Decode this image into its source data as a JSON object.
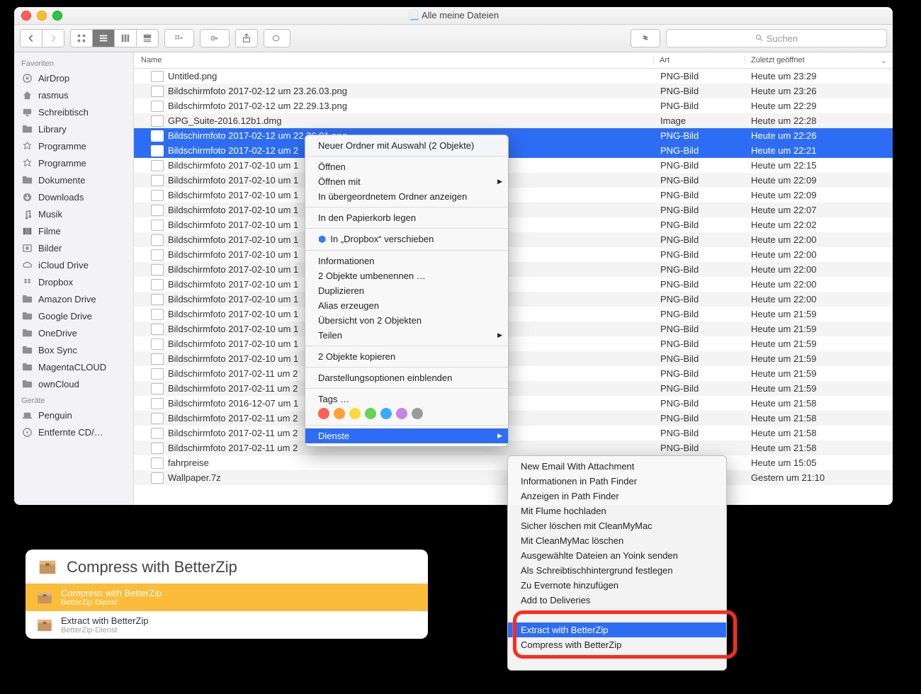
{
  "window": {
    "title": "📃 Alle meine Dateien"
  },
  "search": {
    "placeholder": "Suchen"
  },
  "sidebar": {
    "favorites_label": "Favoriten",
    "devices_label": "Geräte",
    "items": [
      {
        "label": "AirDrop",
        "icon": "airdrop"
      },
      {
        "label": "rasmus",
        "icon": "home"
      },
      {
        "label": "Schreibtisch",
        "icon": "desktop"
      },
      {
        "label": "Library",
        "icon": "folder"
      },
      {
        "label": "Programme",
        "icon": "apps"
      },
      {
        "label": "Programme",
        "icon": "apps"
      },
      {
        "label": "Dokumente",
        "icon": "folder"
      },
      {
        "label": "Downloads",
        "icon": "downloads"
      },
      {
        "label": "Musik",
        "icon": "music"
      },
      {
        "label": "Filme",
        "icon": "movies"
      },
      {
        "label": "Bilder",
        "icon": "photos"
      },
      {
        "label": "iCloud Drive",
        "icon": "icloud"
      },
      {
        "label": "Dropbox",
        "icon": "dropbox"
      },
      {
        "label": "Amazon Drive",
        "icon": "folder"
      },
      {
        "label": "Google Drive",
        "icon": "folder"
      },
      {
        "label": "OneDrive",
        "icon": "folder"
      },
      {
        "label": "Box Sync",
        "icon": "folder"
      },
      {
        "label": "MagentaCLOUD",
        "icon": "folder"
      },
      {
        "label": "ownCloud",
        "icon": "folder"
      }
    ],
    "devices": [
      {
        "label": "Penguin",
        "icon": "laptop"
      },
      {
        "label": "Entfernte CD/…",
        "icon": "disc"
      }
    ]
  },
  "columns": {
    "name": "Name",
    "art": "Art",
    "date": "Zuletzt geöffnet"
  },
  "files": [
    {
      "name": "Untitled.png",
      "art": "PNG-Bild",
      "date": "Heute um 23:29",
      "selected": false
    },
    {
      "name": "Bildschirmfoto 2017-02-12 um 23.26.03.png",
      "art": "PNG-Bild",
      "date": "Heute um 23:26",
      "selected": false
    },
    {
      "name": "Bildschirmfoto 2017-02-12 um 22.29.13.png",
      "art": "PNG-Bild",
      "date": "Heute um 22:29",
      "selected": false
    },
    {
      "name": "GPG_Suite-2016.12b1.dmg",
      "art": "Image",
      "date": "Heute um 22:28",
      "selected": false
    },
    {
      "name": "Bildschirmfoto 2017-02-12 um 22.26.01.png",
      "art": "PNG-Bild",
      "date": "Heute um 22:26",
      "selected": true
    },
    {
      "name": "Bildschirmfoto 2017-02-12 um 2",
      "art": "PNG-Bild",
      "date": "Heute um 22:21",
      "selected": true
    },
    {
      "name": "Bildschirmfoto 2017-02-10 um 1",
      "art": "PNG-Bild",
      "date": "Heute um 22:15",
      "selected": false
    },
    {
      "name": "Bildschirmfoto 2017-02-10 um 1",
      "art": "PNG-Bild",
      "date": "Heute um 22:09",
      "selected": false
    },
    {
      "name": "Bildschirmfoto 2017-02-10 um 1",
      "art": "PNG-Bild",
      "date": "Heute um 22:09",
      "selected": false
    },
    {
      "name": "Bildschirmfoto 2017-02-10 um 1",
      "art": "PNG-Bild",
      "date": "Heute um 22:07",
      "selected": false
    },
    {
      "name": "Bildschirmfoto 2017-02-10 um 1",
      "art": "PNG-Bild",
      "date": "Heute um 22:02",
      "selected": false
    },
    {
      "name": "Bildschirmfoto 2017-02-10 um 1",
      "art": "PNG-Bild",
      "date": "Heute um 22:00",
      "selected": false
    },
    {
      "name": "Bildschirmfoto 2017-02-10 um 1",
      "art": "PNG-Bild",
      "date": "Heute um 22:00",
      "selected": false
    },
    {
      "name": "Bildschirmfoto 2017-02-10 um 1",
      "art": "PNG-Bild",
      "date": "Heute um 22:00",
      "selected": false
    },
    {
      "name": "Bildschirmfoto 2017-02-10 um 1",
      "art": "PNG-Bild",
      "date": "Heute um 22:00",
      "selected": false
    },
    {
      "name": "Bildschirmfoto 2017-02-10 um 1",
      "art": "PNG-Bild",
      "date": "Heute um 22:00",
      "selected": false
    },
    {
      "name": "Bildschirmfoto 2017-02-10 um 1",
      "art": "PNG-Bild",
      "date": "Heute um 21:59",
      "selected": false
    },
    {
      "name": "Bildschirmfoto 2017-02-10 um 1",
      "art": "PNG-Bild",
      "date": "Heute um 21:59",
      "selected": false
    },
    {
      "name": "Bildschirmfoto 2017-02-10 um 1",
      "art": "PNG-Bild",
      "date": "Heute um 21:59",
      "selected": false
    },
    {
      "name": "Bildschirmfoto 2017-02-10 um 1",
      "art": "PNG-Bild",
      "date": "Heute um 21:59",
      "selected": false
    },
    {
      "name": "Bildschirmfoto 2017-02-11 um 2",
      "art": "PNG-Bild",
      "date": "Heute um 21:59",
      "selected": false
    },
    {
      "name": "Bildschirmfoto 2017-02-11 um 2",
      "art": "PNG-Bild",
      "date": "Heute um 21:59",
      "selected": false
    },
    {
      "name": "Bildschirmfoto 2016-12-07 um 1",
      "art": "PNG-Bild",
      "date": "Heute um 21:58",
      "selected": false
    },
    {
      "name": "Bildschirmfoto 2017-02-11 um 2",
      "art": "PNG-Bild",
      "date": "Heute um 21:58",
      "selected": false
    },
    {
      "name": "Bildschirmfoto 2017-02-11 um 2",
      "art": "PNG-Bild",
      "date": "Heute um 21:58",
      "selected": false
    },
    {
      "name": "Bildschirmfoto 2017-02-11 um 2",
      "art": "PNG-Bild",
      "date": "Heute um 21:58",
      "selected": false
    },
    {
      "name": "fahrpreise",
      "art": "",
      "date": "Heute um 15:05",
      "selected": false
    },
    {
      "name": "Wallpaper.7z",
      "art": "",
      "date": "Gestern um 21:10",
      "selected": false
    }
  ],
  "context_menu": {
    "new_folder": "Neuer Ordner mit Auswahl (2 Objekte)",
    "open": "Öffnen",
    "open_with": "Öffnen mit",
    "reveal": "In übergeordnetem Ordner anzeigen",
    "trash": "In den Papierkorb legen",
    "dropbox": "In „Dropbox“ verschieben",
    "info": "Informationen",
    "rename": "2 Objekte umbenennen …",
    "duplicate": "Duplizieren",
    "alias": "Alias erzeugen",
    "quicklook": "Übersicht von 2 Objekten",
    "share": "Teilen",
    "copy": "2 Objekte kopieren",
    "view_opts": "Darstellungsoptionen einblenden",
    "tags": "Tags …",
    "services": "Dienste"
  },
  "tag_colors": [
    "#ff5f57",
    "#ffa030",
    "#ffd93b",
    "#62d552",
    "#3aa8ff",
    "#c585e6",
    "#9b9b9b"
  ],
  "services_menu": [
    {
      "label": "New Email With Attachment"
    },
    {
      "label": "Informationen in Path Finder"
    },
    {
      "label": "Anzeigen in Path Finder"
    },
    {
      "label": "Mit Flume hochladen"
    },
    {
      "label": "Sicher löschen mit CleanMyMac"
    },
    {
      "label": "Mit CleanMyMac löschen"
    },
    {
      "label": "Ausgewählte Dateien an Yoink senden"
    },
    {
      "label": "Als Schreibtischhintergrund festlegen"
    },
    {
      "label": "Zu Evernote hinzufügen"
    },
    {
      "label": "Add to Deliveries"
    },
    {
      "label": ""
    },
    {
      "label": "Extract with BetterZip",
      "hl": true
    },
    {
      "label": "Compress with BetterZip"
    },
    {
      "label": ""
    }
  ],
  "spotlight": {
    "heading": "Compress with BetterZip",
    "items": [
      {
        "title": "Compress with BetterZip",
        "sub": "BetterZip-Dienst",
        "hl": true
      },
      {
        "title": "Extract with BetterZip",
        "sub": "BetterZip-Dienst",
        "hl": false
      }
    ]
  }
}
